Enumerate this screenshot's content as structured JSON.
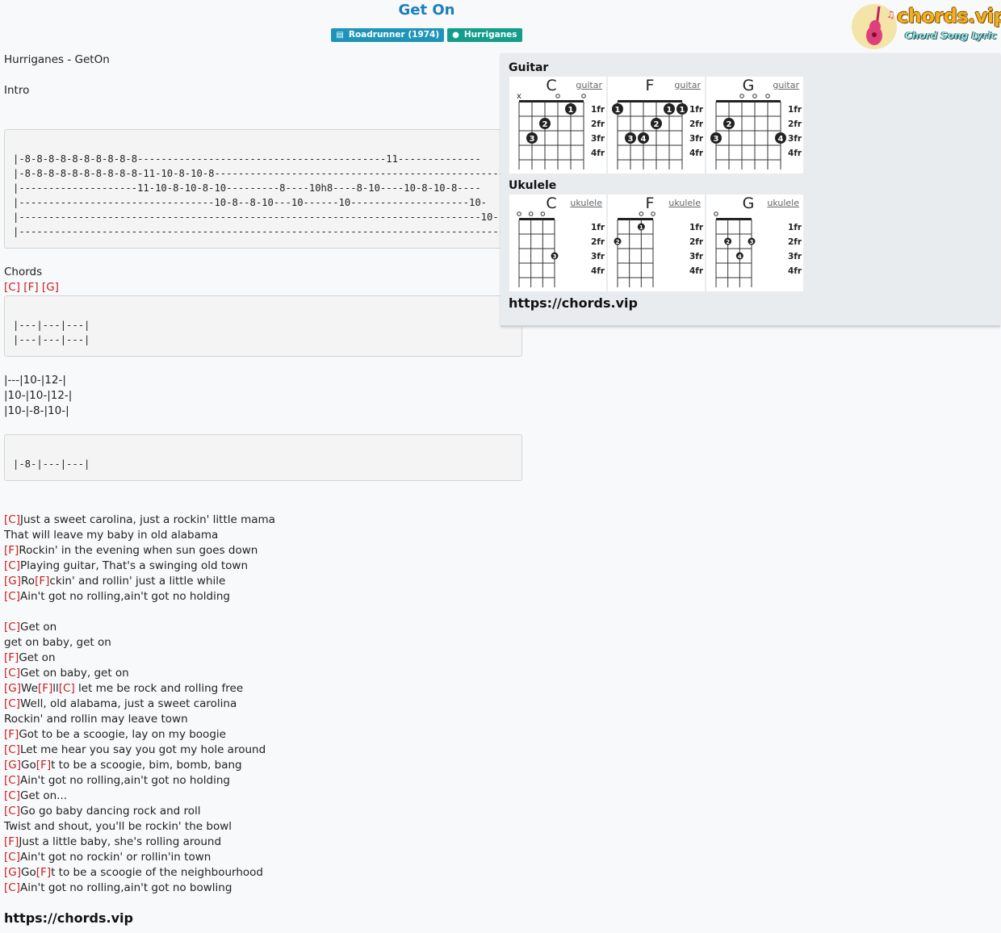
{
  "header": {
    "title": "Get On",
    "album_badge": "Roadrunner (1974)",
    "artist_badge": "Hurriganes",
    "logo_text": "chords.vip",
    "logo_sub": "Chord Song Lyric"
  },
  "song": {
    "heading": "Hurriganes - GetOn",
    "intro_label": "Intro",
    "intro_tab": [
      "|-8-8-8-8-8-8-8-8-8-8------------------------------------------11--------------",
      "|-8-8-8-8-8-8-8-8-8-8-11-10-8-10-8-------------------------------------------------",
      "|--------------------11-10-8-10-8-10---------8----10h8----8-10----10-8-10-8----",
      "|---------------------------------10-8--8-10---10------10--------------------10-",
      "|------------------------------------------------------------------------------10-",
      "|-----------------------------------------------------------------------------------"
    ],
    "chords_label": "Chords",
    "chords_line": [
      "C",
      "F",
      "G"
    ],
    "chords_tab": [
      "|---|---|---|",
      "|---|---|---|"
    ],
    "plain_tab": [
      "|---|10-|12-|",
      "|10-|10-|12-|",
      "|10-|-8-|10-|"
    ],
    "small_tab": [
      "|-8-|---|---|"
    ],
    "lyrics": [
      [
        {
          "c": "C"
        },
        {
          "t": "Just a sweet carolina, just a rockin' little mama"
        }
      ],
      [
        {
          "t": "That will leave my baby in old alabama"
        }
      ],
      [
        {
          "c": "F"
        },
        {
          "t": "Rockin' in the evening when sun goes down"
        }
      ],
      [
        {
          "c": "C"
        },
        {
          "t": "Playing guitar, That's a swinging old town"
        }
      ],
      [
        {
          "c": "G"
        },
        {
          "t": "Ro"
        },
        {
          "c": "F"
        },
        {
          "t": "ckin' and rollin' just a little while"
        }
      ],
      [
        {
          "c": "C"
        },
        {
          "t": "Ain't got no rolling,ain't got no holding"
        }
      ],
      [],
      [
        {
          "c": "C"
        },
        {
          "t": "Get on"
        }
      ],
      [
        {
          "t": "get on baby, get on"
        }
      ],
      [
        {
          "c": "F"
        },
        {
          "t": "Get on"
        }
      ],
      [
        {
          "c": "C"
        },
        {
          "t": "Get on baby, get on"
        }
      ],
      [
        {
          "c": "G"
        },
        {
          "t": "We"
        },
        {
          "c": "F"
        },
        {
          "t": "ll"
        },
        {
          "c": "C"
        },
        {
          "t": " let me be rock and rolling free"
        }
      ],
      [
        {
          "c": "C"
        },
        {
          "t": "Well, old alabama, just a sweet carolina"
        }
      ],
      [
        {
          "t": "Rockin' and rollin may leave town"
        }
      ],
      [
        {
          "c": "F"
        },
        {
          "t": "Got to be a scoogie, lay on my boogie"
        }
      ],
      [
        {
          "c": "C"
        },
        {
          "t": "Let me hear you say you got my hole around"
        }
      ],
      [
        {
          "c": "G"
        },
        {
          "t": "Go"
        },
        {
          "c": "F"
        },
        {
          "t": "t to be a scoogie, bim, bomb, bang"
        }
      ],
      [
        {
          "c": "C"
        },
        {
          "t": "Ain't got no rolling,ain't got no holding"
        }
      ],
      [
        {
          "c": "C"
        },
        {
          "t": "Get on..."
        }
      ],
      [
        {
          "c": "C"
        },
        {
          "t": "Go go baby dancing rock and roll"
        }
      ],
      [
        {
          "t": "Twist and shout, you'll be rockin' the bowl"
        }
      ],
      [
        {
          "c": "F"
        },
        {
          "t": "Just a little baby, she's rolling around"
        }
      ],
      [
        {
          "c": "C"
        },
        {
          "t": "Ain't got no rockin' or rollin'in town"
        }
      ],
      [
        {
          "c": "G"
        },
        {
          "t": "Go"
        },
        {
          "c": "F"
        },
        {
          "t": "t to be a scoogie of the neighbourhood"
        }
      ],
      [
        {
          "c": "C"
        },
        {
          "t": "Ain't got no rolling,ain't got no bowling"
        }
      ]
    ],
    "footer_link": "https://chords.vip"
  },
  "panel": {
    "guitar_label": "Guitar",
    "ukulele_label": "Ukulele",
    "link": "https://chords.vip",
    "fret_labels": [
      "1fr",
      "2fr",
      "3fr",
      "4fr"
    ],
    "guitar_chords": [
      {
        "name": "C",
        "type": "guitar",
        "open": [
          "x",
          "",
          "",
          "o",
          "",
          "o"
        ],
        "dots": [
          {
            "s": 5,
            "f": 1,
            "n": "1"
          },
          {
            "s": 3,
            "f": 2,
            "n": "2"
          },
          {
            "s": 2,
            "f": 3,
            "n": "3"
          }
        ],
        "barre": null
      },
      {
        "name": "F",
        "type": "guitar",
        "open": [
          "",
          "",
          "",
          "",
          "",
          ""
        ],
        "dots": [
          {
            "s": 1,
            "f": 1,
            "n": "1"
          },
          {
            "s": 5,
            "f": 1,
            "n": "1"
          },
          {
            "s": 6,
            "f": 1,
            "n": "1"
          },
          {
            "s": 4,
            "f": 2,
            "n": "2"
          },
          {
            "s": 2,
            "f": 3,
            "n": "3"
          },
          {
            "s": 3,
            "f": 3,
            "n": "4"
          }
        ],
        "barre": null
      },
      {
        "name": "G",
        "type": "guitar",
        "open": [
          "",
          "",
          "o",
          "o",
          "o",
          ""
        ],
        "dots": [
          {
            "s": 2,
            "f": 2,
            "n": "2"
          },
          {
            "s": 1,
            "f": 3,
            "n": "3"
          },
          {
            "s": 6,
            "f": 3,
            "n": "4"
          }
        ],
        "barre": null
      }
    ],
    "ukulele_chords": [
      {
        "name": "C",
        "type": "ukulele",
        "open": [
          "o",
          "o",
          "o",
          ""
        ],
        "dots": [
          {
            "s": 4,
            "f": 3,
            "n": "3"
          }
        ]
      },
      {
        "name": "F",
        "type": "ukulele",
        "open": [
          "",
          "",
          "o",
          "o"
        ],
        "dots": [
          {
            "s": 1,
            "f": 2,
            "n": "2"
          },
          {
            "s": 3,
            "f": 1,
            "n": "1"
          }
        ]
      },
      {
        "name": "G",
        "type": "ukulele",
        "open": [
          "o",
          "",
          "",
          ""
        ],
        "dots": [
          {
            "s": 2,
            "f": 2,
            "n": "2"
          },
          {
            "s": 4,
            "f": 2,
            "n": "3"
          },
          {
            "s": 3,
            "f": 3,
            "n": "4"
          }
        ]
      }
    ]
  },
  "colors": {
    "chord": "#c81e1e",
    "title": "#1a7fbf",
    "album_badge": "#1e95b8",
    "artist_badge": "#129e8a"
  }
}
